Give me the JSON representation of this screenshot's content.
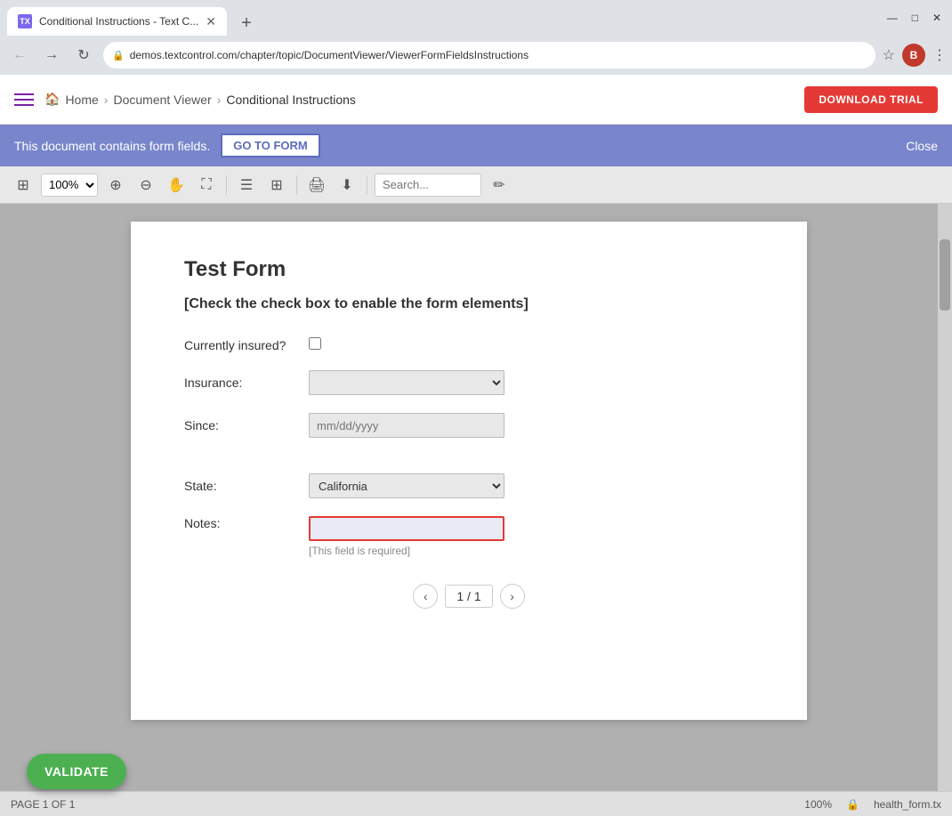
{
  "browser": {
    "tab_title": "Conditional Instructions - Text C...",
    "tab_icon": "TX",
    "new_tab_icon": "+",
    "address": "demos.textcontrol.com/chapter/topic/DocumentViewer/ViewerFormFieldsInstructions",
    "lock_icon": "🔒",
    "profile_letter": "B",
    "window_controls": [
      "—",
      "□",
      "✕"
    ]
  },
  "appbar": {
    "home": "Home",
    "sep1": "›",
    "document_viewer": "Document Viewer",
    "sep2": "›",
    "current": "Conditional Instructions",
    "download_btn": "DOWNLOAD TRIAL"
  },
  "notification": {
    "text": "This document contains form fields.",
    "goto_btn": "GO TO FORM",
    "close": "Close"
  },
  "toolbar": {
    "zoom": "100%",
    "search_placeholder": "Search..."
  },
  "form": {
    "title": "Test Form",
    "subtitle": "[Check the check box to enable the form elements]",
    "fields": [
      {
        "label": "Currently insured?",
        "type": "checkbox",
        "value": ""
      },
      {
        "label": "Insurance:",
        "type": "select",
        "value": "",
        "options": [
          ""
        ]
      },
      {
        "label": "Since:",
        "type": "date",
        "placeholder": "mm/dd/yyyy"
      },
      {
        "label": "State:",
        "type": "select",
        "value": "California",
        "options": [
          "California"
        ]
      },
      {
        "label": "Notes:",
        "type": "text",
        "value": "",
        "required": true,
        "required_msg": "[This field is required]"
      }
    ],
    "pagination": {
      "prev": "‹",
      "info": "1 / 1",
      "next": "›"
    }
  },
  "status_bar": {
    "page_info": "PAGE 1 OF 1",
    "zoom": "100%",
    "lock_icon": "🔒",
    "filename": "health_form.tx"
  },
  "validate_btn": "VALIDATE"
}
